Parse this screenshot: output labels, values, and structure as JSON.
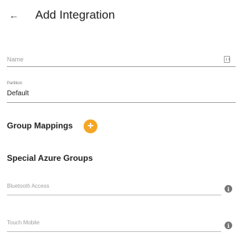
{
  "header": {
    "back_glyph": "←",
    "title": "Add Integration"
  },
  "form": {
    "name": {
      "placeholder": "Name",
      "value": ""
    },
    "partition": {
      "label": "Partition",
      "value": "Default"
    }
  },
  "group_mappings": {
    "title": "Group Mappings",
    "add_glyph": "+"
  },
  "special_azure_groups": {
    "title": "Special Azure Groups",
    "fields": [
      {
        "placeholder": "Bluetooth Access"
      },
      {
        "placeholder": "Touch Mobile"
      }
    ],
    "info_glyph": "i"
  },
  "colors": {
    "accent": "#f5a623",
    "text": "#212121",
    "muted": "#9e9e9e"
  }
}
